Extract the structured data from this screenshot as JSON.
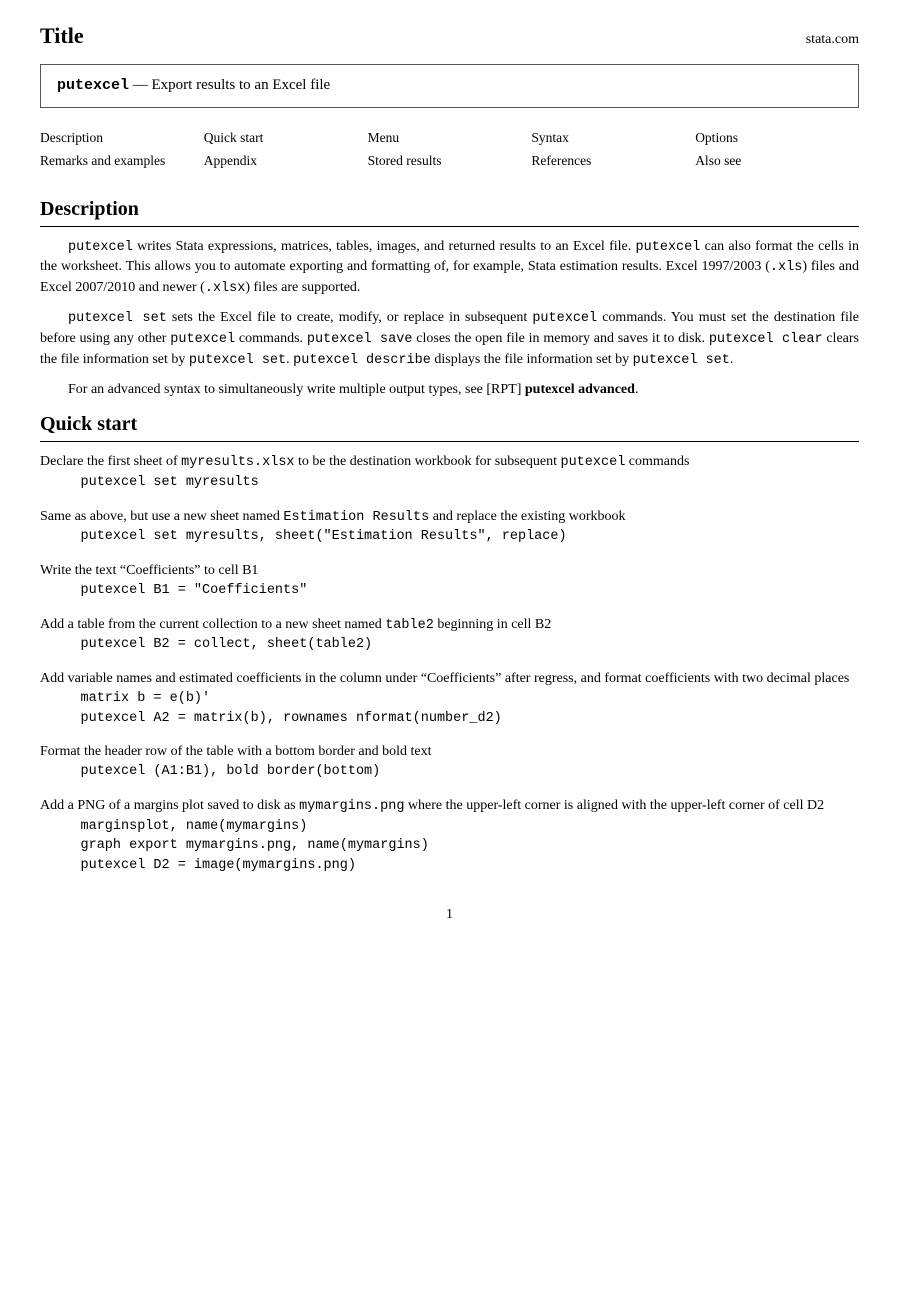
{
  "header": {
    "title": "Title",
    "site": "stata.com"
  },
  "titleBox": {
    "cmd": "putexcel",
    "rest": " — Export results to an Excel file"
  },
  "nav": {
    "rows": [
      [
        "Description",
        "Quick start",
        "Menu",
        "Syntax",
        "Options"
      ],
      [
        "Remarks and examples",
        "Appendix",
        "Stored results",
        "References",
        "Also see"
      ]
    ]
  },
  "description": {
    "heading": "Description",
    "paragraphs": [
      "putexcel writes Stata expressions, matrices, tables, images, and returned results to an Excel file. putexcel can also format the cells in the worksheet. This allows you to automate exporting and formatting of, for example, Stata estimation results. Excel 1997/2003 (.xls) files and Excel 2007/2010 and newer (.xlsx) files are supported.",
      "putexcel set sets the Excel file to create, modify, or replace in subsequent putexcel commands. You must set the destination file before using any other putexcel commands. putexcel save closes the open file in memory and saves it to disk. putexcel clear clears the file information set by putexcel set. putexcel describe displays the file information set by putexcel set.",
      "For an advanced syntax to simultaneously write multiple output types, see [RPT] putexcel advanced."
    ]
  },
  "quickstart": {
    "heading": "Quick start",
    "items": [
      {
        "desc": "Declare the first sheet of myresults.xlsx to be the destination workbook for subsequent putexcel commands",
        "code": [
          "putexcel set myresults"
        ]
      },
      {
        "desc": "Same as above, but use a new sheet named Estimation Results and replace the existing workbook",
        "code": [
          "putexcel set myresults, sheet(\"Estimation Results\", replace)"
        ]
      },
      {
        "desc": "Write the text “Coefficients” to cell B1",
        "code": [
          "putexcel B1 = \"Coefficients\""
        ]
      },
      {
        "desc": "Add a table from the current collection to a new sheet named table2 beginning in cell B2",
        "code": [
          "putexcel B2 = collect, sheet(table2)"
        ]
      },
      {
        "desc": "Add variable names and estimated coefficients in the column under “Coefficients” after regress, and format coefficients with two decimal places",
        "code": [
          "matrix b = e(b)'",
          "putexcel A2 = matrix(b), rownames nformat(number_d2)"
        ]
      },
      {
        "desc": "Format the header row of the table with a bottom border and bold text",
        "code": [
          "putexcel (A1:B1), bold border(bottom)"
        ]
      },
      {
        "desc": "Add a PNG of a margins plot saved to disk as mymargins.png where the upper-left corner is aligned with the upper-left corner of cell D2",
        "code": [
          "marginsplot, name(mymargins)",
          "graph export mymargins.png, name(mymargins)",
          "putexcel D2 = image(mymargins.png)"
        ]
      }
    ]
  },
  "page": {
    "number": "1"
  }
}
